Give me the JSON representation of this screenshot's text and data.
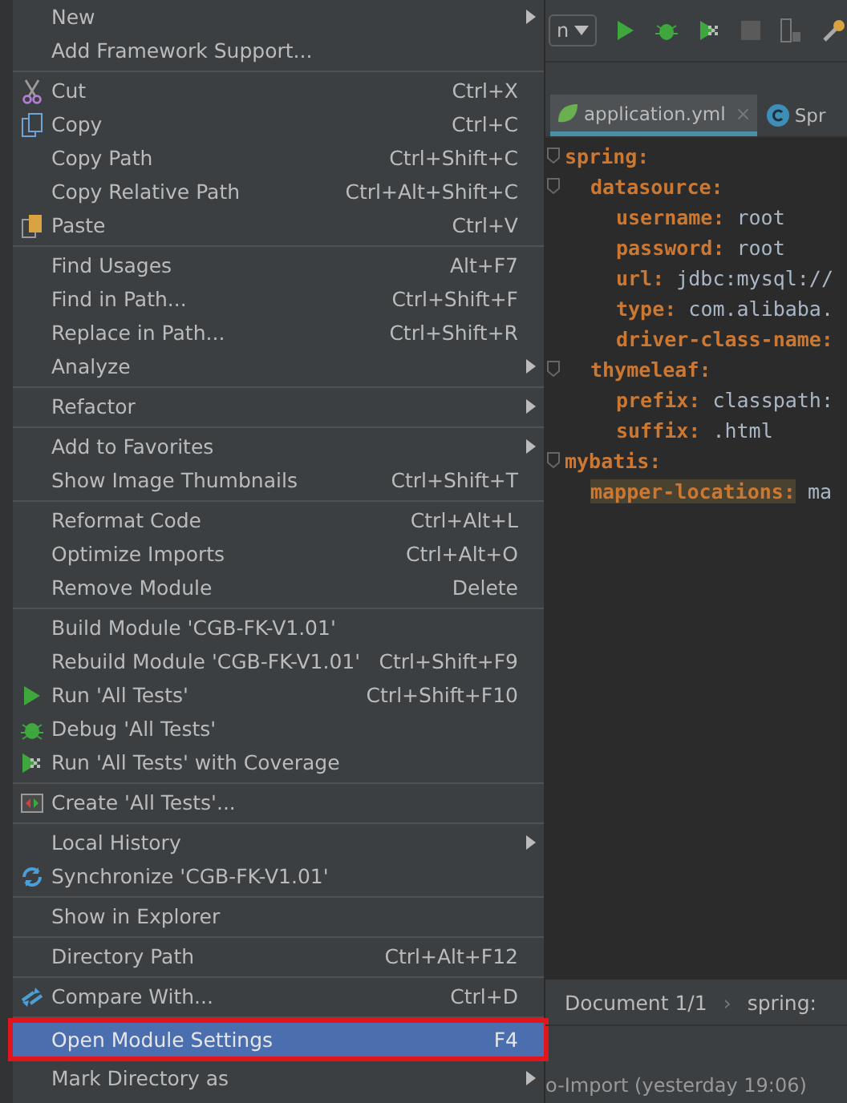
{
  "toolbar": {
    "config_dropdown": "n"
  },
  "editor_tabs": [
    {
      "label": "application.yml",
      "kind": "yaml",
      "selected": true,
      "close": "×"
    },
    {
      "label": "Spr",
      "kind": "class",
      "selected": false
    }
  ],
  "code": [
    {
      "key": "spring:",
      "highlighted": false,
      "children": [
        {
          "key": "datasource:",
          "highlighted": false,
          "children": [
            {
              "key": "username:",
              "value": "root",
              "highlighted": false
            },
            {
              "key": "password:",
              "value": "root",
              "highlighted": false
            },
            {
              "key": "url:",
              "value": "jdbc:mysql://",
              "highlighted": false
            },
            {
              "key": "type:",
              "value": "com.alibaba.",
              "highlighted": false
            },
            {
              "key": "driver-class-name:",
              "highlighted": false
            }
          ]
        },
        {
          "key": "thymeleaf:",
          "highlighted": false,
          "children": [
            {
              "key": "prefix:",
              "value": "classpath:",
              "highlighted": false
            },
            {
              "key": "suffix:",
              "value": ".html",
              "highlighted": false
            }
          ]
        }
      ]
    },
    {
      "key": "mybatis:",
      "highlighted": false,
      "children": [
        {
          "key": "mapper-locations:",
          "value": "ma",
          "highlighted": true
        }
      ]
    }
  ],
  "breadcrumb": {
    "items": [
      "Document 1/1",
      "spring:"
    ],
    "separator": "›"
  },
  "status": "o-Import (yesterday 19:06)",
  "menu": {
    "sections": [
      [
        {
          "label": "New",
          "kind": "text",
          "submenu": true,
          "selected": false
        },
        {
          "label": "Add Framework Support...",
          "kind": "text",
          "submenu": false,
          "selected": false
        }
      ],
      [
        {
          "label": "Cut",
          "shortcut": "Ctrl+X",
          "kind": "cut",
          "submenu": false,
          "selected": false
        },
        {
          "label": "Copy",
          "shortcut": "Ctrl+C",
          "kind": "copy",
          "submenu": false,
          "selected": false
        },
        {
          "label": "Copy Path",
          "shortcut": "Ctrl+Shift+C",
          "kind": "text",
          "submenu": false,
          "selected": false
        },
        {
          "label": "Copy Relative Path",
          "shortcut": "Ctrl+Alt+Shift+C",
          "kind": "text",
          "submenu": false,
          "selected": false
        },
        {
          "label": "Paste",
          "shortcut": "Ctrl+V",
          "kind": "paste",
          "submenu": false,
          "selected": false
        }
      ],
      [
        {
          "label": "Find Usages",
          "shortcut": "Alt+F7",
          "kind": "text",
          "submenu": false,
          "selected": false
        },
        {
          "label": "Find in Path...",
          "shortcut": "Ctrl+Shift+F",
          "kind": "text",
          "submenu": false,
          "selected": false
        },
        {
          "label": "Replace in Path...",
          "shortcut": "Ctrl+Shift+R",
          "kind": "text",
          "submenu": false,
          "selected": false
        },
        {
          "label": "Analyze",
          "kind": "text",
          "submenu": true,
          "selected": false
        }
      ],
      [
        {
          "label": "Refactor",
          "kind": "text",
          "submenu": true,
          "selected": false
        }
      ],
      [
        {
          "label": "Add to Favorites",
          "kind": "text",
          "submenu": true,
          "selected": false
        },
        {
          "label": "Show Image Thumbnails",
          "shortcut": "Ctrl+Shift+T",
          "kind": "text",
          "submenu": false,
          "selected": false
        }
      ],
      [
        {
          "label": "Reformat Code",
          "shortcut": "Ctrl+Alt+L",
          "kind": "text",
          "submenu": false,
          "selected": false
        },
        {
          "label": "Optimize Imports",
          "shortcut": "Ctrl+Alt+O",
          "kind": "text",
          "submenu": false,
          "selected": false
        },
        {
          "label": "Remove Module",
          "shortcut": "Delete",
          "kind": "text",
          "submenu": false,
          "selected": false
        }
      ],
      [
        {
          "label": "Build Module 'CGB-FK-V1.01'",
          "kind": "text",
          "submenu": false,
          "selected": false
        },
        {
          "label": "Rebuild Module 'CGB-FK-V1.01'",
          "shortcut": "Ctrl+Shift+F9",
          "kind": "text",
          "submenu": false,
          "selected": false
        },
        {
          "label": "Run 'All Tests'",
          "shortcut": "Ctrl+Shift+F10",
          "kind": "run",
          "submenu": false,
          "selected": false
        },
        {
          "label": "Debug 'All Tests'",
          "kind": "debug",
          "submenu": false,
          "selected": false
        },
        {
          "label": "Run 'All Tests' with Coverage",
          "kind": "coverage",
          "submenu": false,
          "selected": false
        }
      ],
      [
        {
          "label": "Create 'All Tests'...",
          "kind": "create-test",
          "submenu": false,
          "selected": false
        }
      ],
      [
        {
          "label": "Local History",
          "kind": "text",
          "submenu": true,
          "selected": false
        },
        {
          "label": "Synchronize 'CGB-FK-V1.01'",
          "kind": "sync",
          "submenu": false,
          "selected": false
        }
      ],
      [
        {
          "label": "Show in Explorer",
          "kind": "text",
          "submenu": false,
          "selected": false
        }
      ],
      [
        {
          "label": "Directory Path",
          "shortcut": "Ctrl+Alt+F12",
          "kind": "text",
          "submenu": false,
          "selected": false
        }
      ],
      [
        {
          "label": "Compare With...",
          "shortcut": "Ctrl+D",
          "kind": "compare",
          "submenu": false,
          "selected": false
        }
      ],
      [
        {
          "label": "Open Module Settings",
          "shortcut": "F4",
          "kind": "text",
          "submenu": false,
          "selected": true
        },
        {
          "label": "Mark Directory as",
          "kind": "text",
          "submenu": true,
          "selected": false
        }
      ]
    ]
  }
}
